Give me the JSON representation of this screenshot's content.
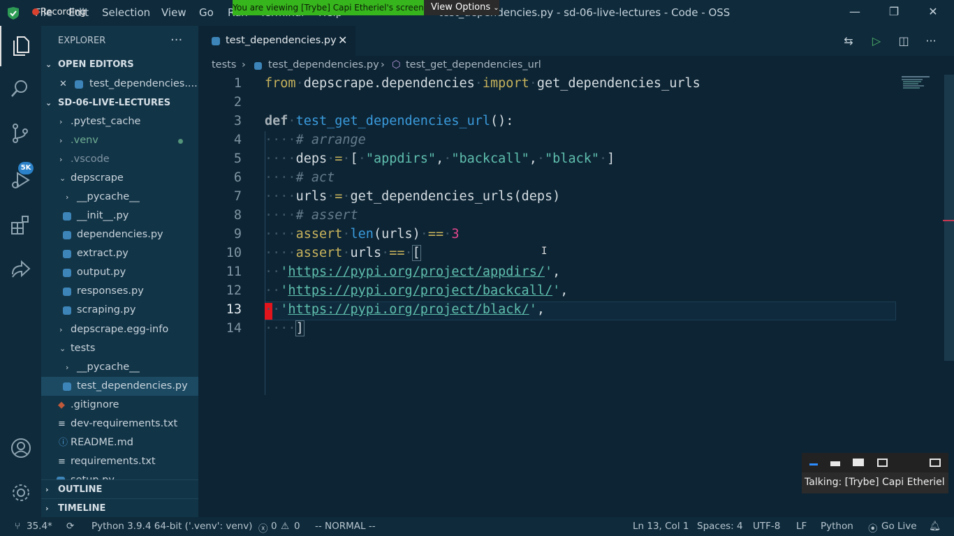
{
  "titlebar": {
    "menu": [
      "File",
      "Edit",
      "Selection",
      "View",
      "Go",
      "Run",
      "Terminal",
      "Help"
    ],
    "title": "test_dependencies.py - sd-06-live-lectures - Code - OSS",
    "recording": "Recording",
    "share_banner": "You are viewing [Trybe] Capi Etheriel's screen",
    "view_options": "View Options"
  },
  "activitybar": {
    "items": [
      "explorer-icon",
      "search-icon",
      "source-control-icon",
      "run-debug-icon",
      "extensions-icon",
      "live-share-icon"
    ],
    "badge": "5K",
    "bottom": [
      "account-icon",
      "settings-gear-icon"
    ]
  },
  "sidebar": {
    "title": "EXPLORER",
    "open_editors": {
      "label": "OPEN EDITORS",
      "files": [
        "test_dependencies...."
      ]
    },
    "workspace": {
      "label": "SD-06-LIVE-LECTURES",
      "items": [
        {
          "label": ".pytest_cache",
          "type": "folder",
          "expanded": false
        },
        {
          "label": ".venv",
          "type": "folder",
          "expanded": false
        },
        {
          "label": ".vscode",
          "type": "folder",
          "expanded": false
        },
        {
          "label": "depscrape",
          "type": "folder",
          "expanded": true
        },
        {
          "label": "__pycache__",
          "type": "folder",
          "expanded": false
        },
        {
          "label": "__init__.py",
          "type": "python"
        },
        {
          "label": "dependencies.py",
          "type": "python"
        },
        {
          "label": "extract.py",
          "type": "python"
        },
        {
          "label": "output.py",
          "type": "python"
        },
        {
          "label": "responses.py",
          "type": "python"
        },
        {
          "label": "scraping.py",
          "type": "python"
        },
        {
          "label": "depscrape.egg-info",
          "type": "folder",
          "expanded": false
        },
        {
          "label": "tests",
          "type": "folder",
          "expanded": true
        },
        {
          "label": "__pycache__",
          "type": "folder",
          "expanded": false
        },
        {
          "label": "test_dependencies.py",
          "type": "python",
          "selected": true
        },
        {
          "label": ".gitignore",
          "type": "git"
        },
        {
          "label": "dev-requirements.txt",
          "type": "text"
        },
        {
          "label": "README.md",
          "type": "info"
        },
        {
          "label": "requirements.txt",
          "type": "text"
        },
        {
          "label": "setup.py",
          "type": "python"
        }
      ]
    },
    "outline": "OUTLINE",
    "timeline": "TIMELINE"
  },
  "editor": {
    "tab": "test_dependencies.py",
    "breadcrumbs": [
      "tests",
      "test_dependencies.py",
      "test_get_dependencies_url"
    ],
    "line_numbers": [
      "1",
      "2",
      "3",
      "4",
      "5",
      "6",
      "7",
      "8",
      "9",
      "10",
      "11",
      "12",
      "13",
      "14"
    ],
    "current_line": "13",
    "code": {
      "l1_from": "from",
      "l1_mod": "depscrape.dependencies",
      "l1_import": "import",
      "l1_name": "get_dependencies_urls",
      "l3_def": "def",
      "l3_fn": "test_get_dependencies_url",
      "l3_tail": "():",
      "l4_comment": "# arrange",
      "l5_var": "deps",
      "l5_s1": "\"appdirs\"",
      "l5_s2": "\"backcall\"",
      "l5_s3": "\"black\"",
      "l6_comment": "# act",
      "l7_var": "urls",
      "l7_call": "get_dependencies_urls(deps)",
      "l8_comment": "# assert",
      "l9_assert": "assert",
      "l9_len": "len",
      "l9_args": "(urls)",
      "l9_num": "3",
      "l10_assert": "assert",
      "l10_urls": "urls",
      "l11_url": "https://pypi.org/project/appdirs/",
      "l12_url": "https://pypi.org/project/backcall/",
      "l13_url": "https://pypi.org/project/black/"
    }
  },
  "statusbar": {
    "branch": "35.4*",
    "python": "Python 3.9.4 64-bit ('.venv': venv)",
    "errors": "0",
    "warnings": "0",
    "mode": "-- NORMAL --",
    "position": "Ln 13, Col 1",
    "spaces": "Spaces: 4",
    "encoding": "UTF-8",
    "eol": "LF",
    "language": "Python",
    "golive": "Go Live"
  },
  "talking": {
    "label": "Talking: [Trybe] Capi Etheriel"
  }
}
